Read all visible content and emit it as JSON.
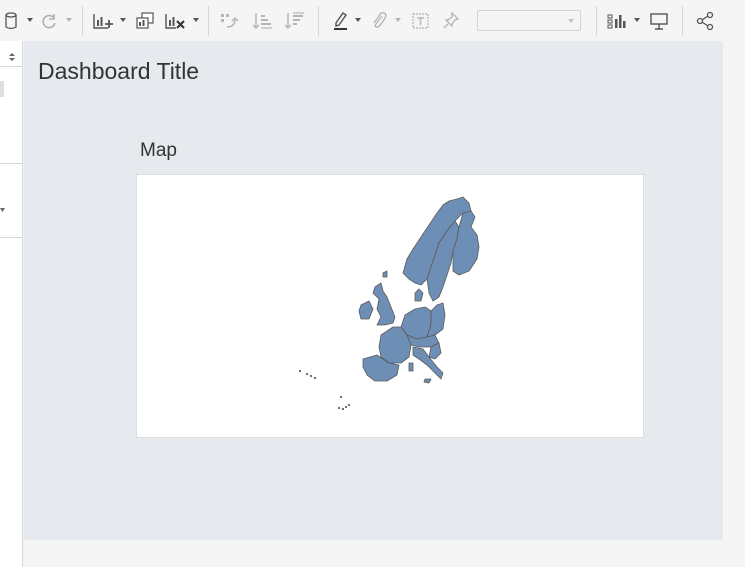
{
  "toolbar": {
    "buttons": [
      {
        "name": "datasource-icon",
        "enabled": true
      },
      {
        "name": "refresh-icon",
        "enabled": false
      },
      {
        "name": "new-worksheet-icon",
        "enabled": true
      },
      {
        "name": "duplicate-sheet-icon",
        "enabled": true
      },
      {
        "name": "clear-sheet-icon",
        "enabled": true
      },
      {
        "name": "swap-rows-columns-icon",
        "enabled": false
      },
      {
        "name": "sort-ascending-icon",
        "enabled": false
      },
      {
        "name": "sort-descending-icon",
        "enabled": false
      },
      {
        "name": "highlight-icon",
        "enabled": true
      },
      {
        "name": "group-icon",
        "enabled": false
      },
      {
        "name": "show-labels-icon",
        "enabled": false
      },
      {
        "name": "pin-icon",
        "enabled": false
      },
      {
        "name": "show-me-icon",
        "enabled": true
      },
      {
        "name": "presentation-icon",
        "enabled": true
      },
      {
        "name": "share-icon",
        "enabled": true
      }
    ],
    "fit_select_value": ""
  },
  "dashboard": {
    "title": "Dashboard Title",
    "map_title": "Map"
  },
  "colors": {
    "canvas_bg": "#e6e9ed",
    "map_fill": "#6e8fb5",
    "map_stroke": "#5a5a5a"
  }
}
